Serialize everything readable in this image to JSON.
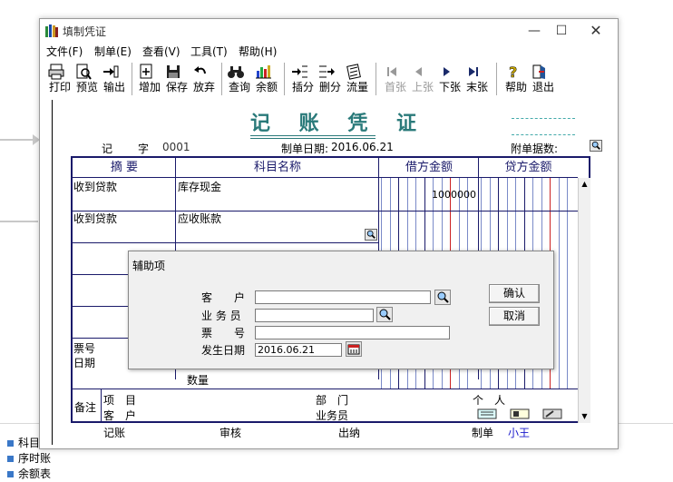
{
  "window": {
    "title": "填制凭证"
  },
  "menu": [
    "文件(F)",
    "制单(E)",
    "查看(V)",
    "工具(T)",
    "帮助(H)"
  ],
  "toolbar": [
    {
      "label": "打印",
      "icon": "printer-icon",
      "enabled": true
    },
    {
      "label": "预览",
      "icon": "preview-icon",
      "enabled": true
    },
    {
      "label": "输出",
      "icon": "export-icon",
      "enabled": true
    },
    {
      "label": "增加",
      "icon": "add-icon",
      "enabled": true
    },
    {
      "label": "保存",
      "icon": "save-icon",
      "enabled": true
    },
    {
      "label": "放弃",
      "icon": "undo-icon",
      "enabled": true
    },
    {
      "label": "查询",
      "icon": "binoculars-icon",
      "enabled": true
    },
    {
      "label": "余额",
      "icon": "balance-chart-icon",
      "enabled": true
    },
    {
      "label": "插分",
      "icon": "insert-row-icon",
      "enabled": true
    },
    {
      "label": "删分",
      "icon": "delete-row-icon",
      "enabled": true
    },
    {
      "label": "流量",
      "icon": "flow-icon",
      "enabled": true
    },
    {
      "label": "首张",
      "icon": "first-icon",
      "enabled": false
    },
    {
      "label": "上张",
      "icon": "prev-icon",
      "enabled": false
    },
    {
      "label": "下张",
      "icon": "next-icon",
      "enabled": true
    },
    {
      "label": "末张",
      "icon": "last-icon",
      "enabled": true
    },
    {
      "label": "帮助",
      "icon": "help-icon",
      "enabled": true
    },
    {
      "label": "退出",
      "icon": "exit-icon",
      "enabled": true
    }
  ],
  "voucher": {
    "title": "记 账 凭 证",
    "word_label": "记",
    "zi_label": "字",
    "number": "0001",
    "date_label": "制单日期:",
    "date": "2016.06.21",
    "attach_label": "附单据数:",
    "columns": [
      "摘 要",
      "科目名称",
      "借方金额",
      "贷方金额"
    ],
    "rows": [
      {
        "summary": "收到贷款",
        "account": "库存现金",
        "debit": "1000000",
        "credit": ""
      },
      {
        "summary": "收到贷款",
        "account": "应收账款",
        "debit": "",
        "credit": ""
      }
    ],
    "ticket_label": "票号",
    "period_label": "日期",
    "qty_label": "数量",
    "remark_label": "备注",
    "project_label": "项　目",
    "dept_label": "部　门",
    "person_label": "个　人",
    "customer_label": "客　户",
    "salesman_label": "业务员",
    "footer": {
      "bookkeeper": "记账",
      "reviewer": "审核",
      "cashier": "出纳",
      "maker": "制单",
      "maker_name": "小王"
    }
  },
  "dialog": {
    "title": "辅助项",
    "customer_label": "客　　户",
    "customer_value": "",
    "salesman_label": "业 务 员",
    "salesman_value": "",
    "ticket_label": "票　　号",
    "ticket_value": "",
    "date_label": "发生日期",
    "date_value": "2016.06.21",
    "ok": "确认",
    "cancel": "取消"
  },
  "background": {
    "list": [
      "科目",
      "序时账",
      "余额表"
    ]
  },
  "colors": {
    "title": "#2a7a7a",
    "grid": "#1a1a6a",
    "red_line": "#cc2222",
    "maker_name": "#1a1acc"
  }
}
